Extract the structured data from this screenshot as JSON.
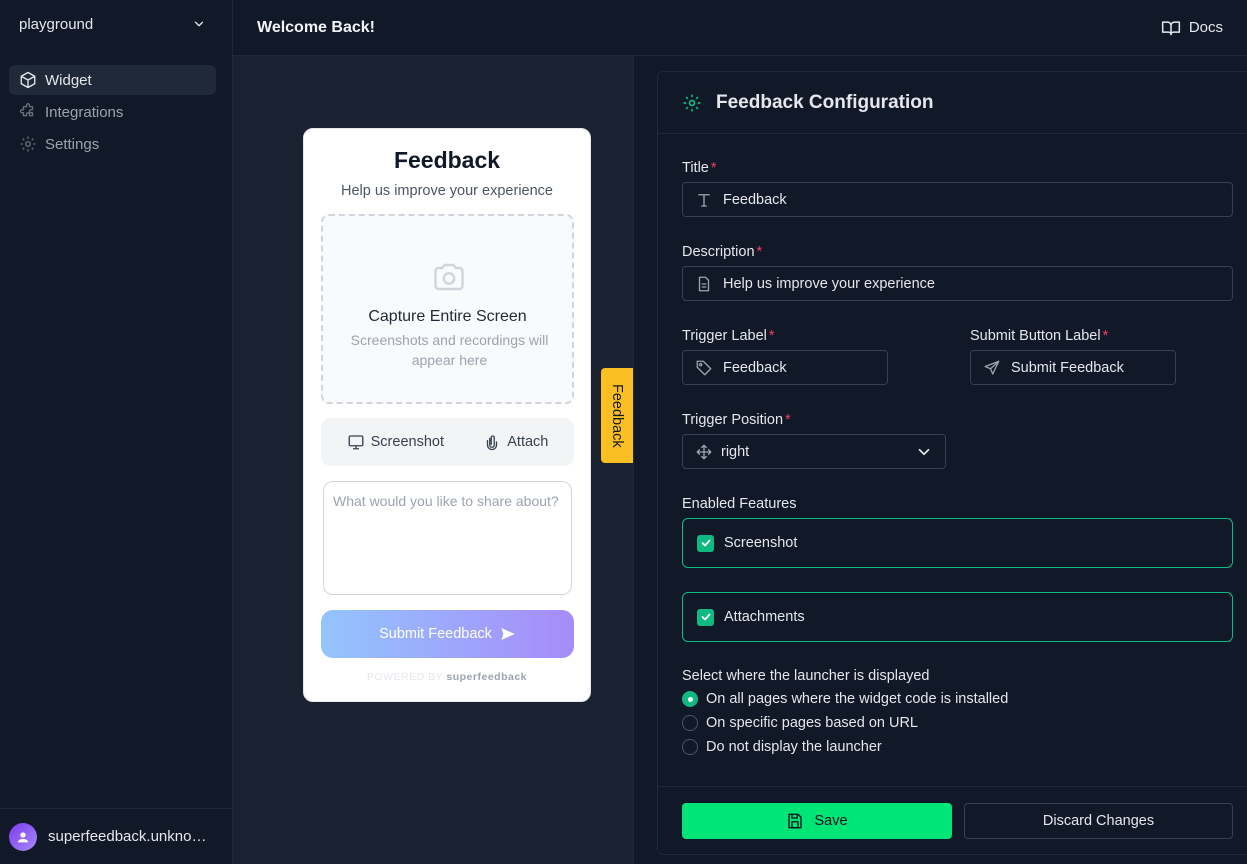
{
  "sidebar": {
    "workspace": "playground",
    "items": [
      {
        "label": "Widget",
        "icon": "cube-icon",
        "active": true
      },
      {
        "label": "Integrations",
        "icon": "puzzle-icon",
        "active": false
      },
      {
        "label": "Settings",
        "icon": "gear-icon",
        "active": false
      }
    ],
    "user": "superfeedback.unknow..."
  },
  "header": {
    "title": "Welcome Back!",
    "docs_label": "Docs"
  },
  "preview": {
    "title": "Feedback",
    "description": "Help us improve your experience",
    "capture_title": "Capture Entire Screen",
    "capture_subtitle": "Screenshots and recordings will appear here",
    "screenshot_label": "Screenshot",
    "attach_label": "Attach",
    "textarea_placeholder": "What would you like to share about?",
    "submit_label": "Submit Feedback",
    "powered_by": "POWERED BY",
    "brand": "superfeedback",
    "trigger_label": "Feedback"
  },
  "config": {
    "title": "Feedback Configuration",
    "title_label": "Title",
    "title_value": "Feedback",
    "description_label": "Description",
    "description_value": "Help us improve your experience",
    "trigger_label_label": "Trigger Label",
    "trigger_label_value": "Feedback",
    "submit_label_label": "Submit Button Label",
    "submit_label_value": "Submit Feedback",
    "trigger_position_label": "Trigger Position",
    "trigger_position_value": "right",
    "enabled_features_label": "Enabled Features",
    "features": [
      {
        "label": "Screenshot",
        "checked": true
      },
      {
        "label": "Attachments",
        "checked": true
      }
    ],
    "launcher_label": "Select where the launcher is displayed",
    "launcher_options": [
      {
        "label": "On all pages where the widget code is installed",
        "checked": true
      },
      {
        "label": "On specific pages based on URL",
        "checked": false
      },
      {
        "label": "Do not display the launcher",
        "checked": false
      }
    ],
    "save_label": "Save",
    "discard_label": "Discard Changes"
  },
  "colors": {
    "background": "#111827",
    "accent": "#00e676",
    "feature_border": "#10b981",
    "trigger_tab": "#fbbf24",
    "required": "#f43f5e"
  }
}
